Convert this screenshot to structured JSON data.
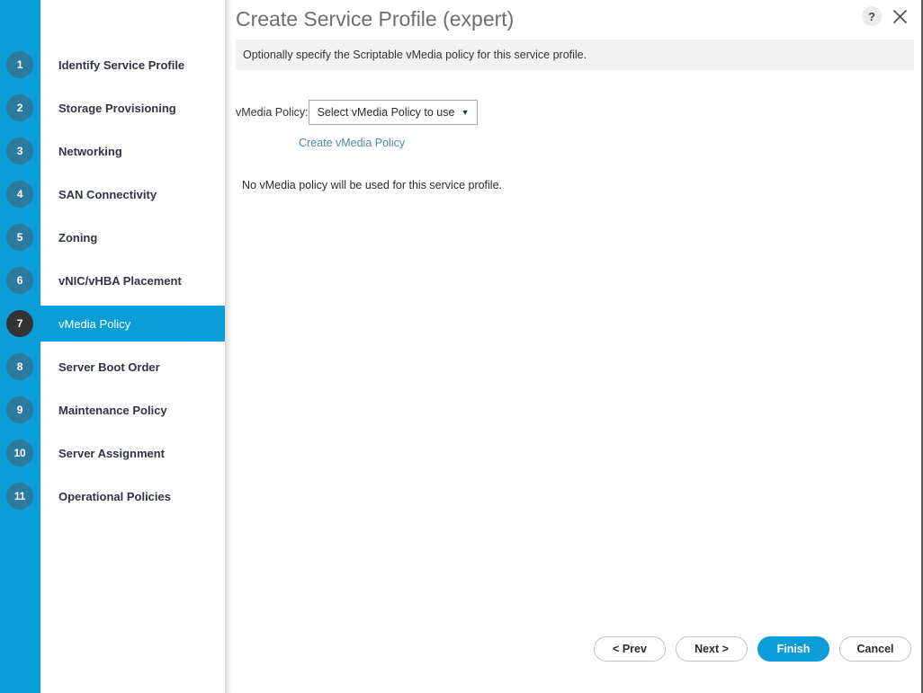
{
  "dialog": {
    "title": "Create Service Profile (expert)",
    "instruction": "Optionally specify the Scriptable vMedia policy for this service profile.",
    "help_icon": "?",
    "help_icon_name": "help-icon",
    "close_icon_name": "close-icon"
  },
  "wizard": {
    "steps": [
      {
        "number": "1",
        "label": "Identify Service Profile",
        "active": false
      },
      {
        "number": "2",
        "label": "Storage Provisioning",
        "active": false
      },
      {
        "number": "3",
        "label": "Networking",
        "active": false
      },
      {
        "number": "4",
        "label": "SAN Connectivity",
        "active": false
      },
      {
        "number": "5",
        "label": "Zoning",
        "active": false
      },
      {
        "number": "6",
        "label": "vNIC/vHBA Placement",
        "active": false
      },
      {
        "number": "7",
        "label": "vMedia Policy",
        "active": true
      },
      {
        "number": "8",
        "label": "Server Boot Order",
        "active": false
      },
      {
        "number": "9",
        "label": "Maintenance Policy",
        "active": false
      },
      {
        "number": "10",
        "label": "Server Assignment",
        "active": false
      },
      {
        "number": "11",
        "label": "Operational Policies",
        "active": false
      }
    ]
  },
  "form": {
    "policy_label": "vMedia Policy:",
    "policy_select_value": "Select vMedia Policy to use",
    "policy_select_caret": "▼",
    "create_policy_link": "Create vMedia Policy",
    "policy_status": "No vMedia policy will be used for this service profile."
  },
  "footer": {
    "buttons": [
      {
        "label": "< Prev",
        "name": "prev-button",
        "primary": false
      },
      {
        "label": "Next >",
        "name": "next-button",
        "primary": false
      },
      {
        "label": "Finish",
        "name": "finish-button",
        "primary": true
      },
      {
        "label": "Cancel",
        "name": "cancel-button",
        "primary": false
      }
    ]
  },
  "colors": {
    "accent": "#0b9dd7",
    "step_badge": "#2c7b9e",
    "active_badge": "#333333",
    "link": "#4d88a8",
    "instruction_bg": "#f2f2f2",
    "title": "#6d6e71"
  }
}
